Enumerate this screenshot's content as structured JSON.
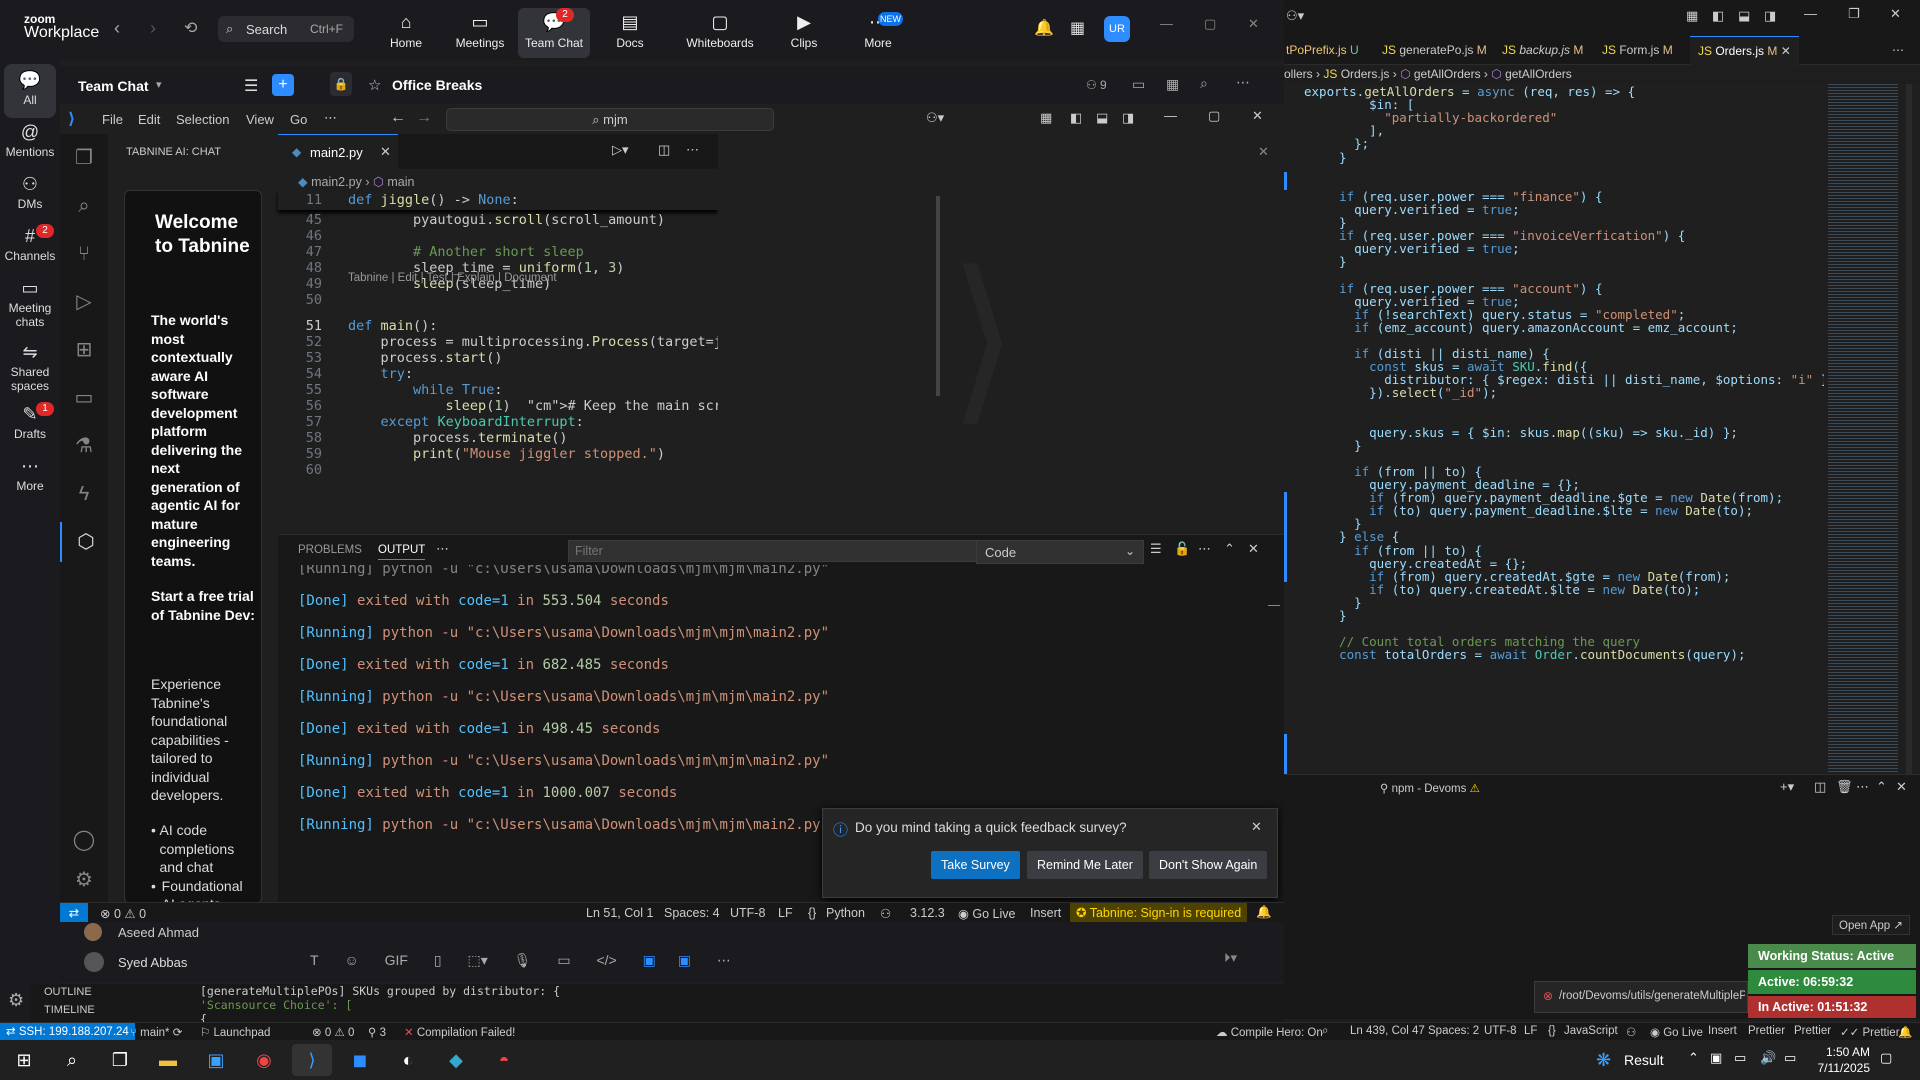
{
  "zoom": {
    "logo_line1": "zoom",
    "logo_line2": "Workplace",
    "search_label": "Search",
    "search_shortcut": "Ctrl+F",
    "tabs": [
      {
        "label": "Home"
      },
      {
        "label": "Meetings"
      },
      {
        "label": "Team Chat",
        "badge": "2"
      },
      {
        "label": "Docs"
      },
      {
        "label": "Whiteboards"
      },
      {
        "label": "Clips"
      },
      {
        "label": "More",
        "badge": "NEW"
      }
    ],
    "avatar": "UR",
    "left_nav": [
      {
        "label": "All"
      },
      {
        "label": "Mentions"
      },
      {
        "label": "DMs"
      },
      {
        "label": "Channels",
        "badge": "2"
      },
      {
        "label": "Meeting chats"
      },
      {
        "label": "Shared spaces"
      },
      {
        "label": "Drafts",
        "badge": "1"
      },
      {
        "label": "More"
      }
    ],
    "section_title": "Team Chat",
    "channel_title": "Office Breaks",
    "member_count": "9",
    "contacts": [
      "Aseed Ahmad",
      "Syed Abbas"
    ]
  },
  "vscode_left": {
    "menu": [
      "File",
      "Edit",
      "Selection",
      "View",
      "Go"
    ],
    "command_center": "mjm",
    "sidebar_title": "TABNINE AI: CHAT",
    "tabnine": {
      "welcome": "Welcome to Tabnine",
      "tagline": "The world's most contextually aware AI software development platform delivering the next generation of agentic AI for mature engineering teams.",
      "trial": "Start a free trial of Tabnine Dev:",
      "experience": "Experience Tabnine's foundational capabilities - tailored to individual developers.",
      "bullets": [
        "AI code completions and chat",
        "Foundational AI agents"
      ]
    },
    "tab": "main2.py",
    "breadcrumb_file": "main2.py",
    "breadcrumb_symbol": "main",
    "sticky_line": {
      "num": "11",
      "text": "def jiggle() -> None:"
    },
    "codelens": "Tabnine | Edit | Test | Explain | Document",
    "lines": [
      {
        "num": "45",
        "code": "        pyautogui.scroll(scroll_amount)"
      },
      {
        "num": "46",
        "code": ""
      },
      {
        "num": "47",
        "code": "        # Another short sleep"
      },
      {
        "num": "48",
        "code": "        sleep_time = uniform(1, 3)"
      },
      {
        "num": "49",
        "code": "        sleep(sleep_time)"
      },
      {
        "num": "50",
        "code": ""
      },
      {
        "num": "51",
        "code": "def main():"
      },
      {
        "num": "52",
        "code": "    process = multiprocessing.Process(target=ji"
      },
      {
        "num": "53",
        "code": "    process.start()"
      },
      {
        "num": "54",
        "code": "    try:"
      },
      {
        "num": "55",
        "code": "        while True:"
      },
      {
        "num": "56",
        "code": "            sleep(1)  # Keep the main script ru"
      },
      {
        "num": "57",
        "code": "    except KeyboardInterrupt:"
      },
      {
        "num": "58",
        "code": "        process.terminate()"
      },
      {
        "num": "59",
        "code": "        print(\"Mouse jiggler stopped.\")"
      },
      {
        "num": "60",
        "code": ""
      }
    ],
    "panel_tabs": [
      "PROBLEMS",
      "OUTPUT"
    ],
    "filter_placeholder": "Filter",
    "output_channel": "Code",
    "output_partial": "[Running] python -u \"c:\\Users\\usama\\Downloads\\mjm\\mjm\\main2.py\"",
    "output": [
      {
        "text": "[Done] exited with code=1 in 553.504 seconds",
        "kind": "done"
      },
      {
        "text": "[Running] python -u \"c:\\Users\\usama\\Downloads\\mjm\\mjm\\main2.py\"",
        "kind": "run"
      },
      {
        "text": "[Done] exited with code=1 in 682.485 seconds",
        "kind": "done"
      },
      {
        "text": "[Running] python -u \"c:\\Users\\usama\\Downloads\\mjm\\mjm\\main2.py\"",
        "kind": "run"
      },
      {
        "text": "[Done] exited with code=1 in 498.45 seconds",
        "kind": "done"
      },
      {
        "text": "[Running] python -u \"c:\\Users\\usama\\Downloads\\mjm\\mjm\\main2.py\"",
        "kind": "run"
      },
      {
        "text": "[Done] exited with code=1 in 1000.007 seconds",
        "kind": "done"
      },
      {
        "text": "[Running] python -u \"c:\\Users\\usama\\Downloads\\mjm\\mjm\\main2.py\"",
        "kind": "run"
      }
    ],
    "survey": {
      "question": "Do you mind taking a quick feedback survey?",
      "take": "Take Survey",
      "remind": "Remind Me Later",
      "dont": "Don't Show Again"
    },
    "status": {
      "errors": "0",
      "warnings": "0",
      "position": "Ln 51, Col 1",
      "spaces": "Spaces: 4",
      "encoding": "UTF-8",
      "eol": "LF",
      "language": "Python",
      "version": "3.12.3",
      "golive": "Go Live",
      "insert": "Insert",
      "tabnine": "Tabnine: Sign-in is required"
    }
  },
  "vscode_right": {
    "tabs": [
      {
        "label": "tPoPrefix.js",
        "flag": "U"
      },
      {
        "label": "generatePo.js",
        "flag": "M"
      },
      {
        "label": "backup.js",
        "flag": "M"
      },
      {
        "label": "Form.js",
        "flag": "M"
      },
      {
        "label": "Orders.js",
        "flag": "M"
      }
    ],
    "breadcrumb": [
      "ollers",
      "Orders.js",
      "getAllOrders",
      "getAllOrders"
    ],
    "code": [
      "exports.getAllOrders = async (req, res) => {",
      "      $in: [",
      "        \"partially-backordered\"",
      "      ],",
      "    };",
      "  }",
      "",
      "",
      "  if (req.user.power === \"finance\") {",
      "    query.verified = true;",
      "  }",
      "  if (req.user.power === \"invoiceVerfication\") {",
      "    query.verified = true;",
      "  }",
      "",
      "  if (req.user.power === \"account\") {",
      "    query.verified = true;",
      "    if (!searchText) query.status = \"completed\";",
      "    if (emz_account) query.amazonAccount = emz_account;",
      "",
      "    if (disti || disti_name) {",
      "      const skus = await SKU.find({",
      "        distributor: { $regex: disti || disti_name, $options: \"i\" }",
      "      }).select(\"_id\");",
      "",
      "",
      "      query.skus = { $in: skus.map((sku) => sku._id) };",
      "    }",
      "",
      "    if (from || to) {",
      "      query.payment_deadline = {};",
      "      if (from) query.payment_deadline.$gte = new Date(from);",
      "      if (to) query.payment_deadline.$lte = new Date(to);",
      "    }",
      "  } else {",
      "    if (from || to) {",
      "      query.createdAt = {};",
      "      if (from) query.createdAt.$gte = new Date(from);",
      "      if (to) query.createdAt.$lte = new Date(to);",
      "    }",
      "  }",
      "",
      "  // Count total orders matching the query",
      "  const totalOrders = await Order.countDocuments(query);"
    ],
    "terminal_name": "npm - Devoms",
    "open_app": "Open App",
    "working_status": "Working Status: Active",
    "active_time": "Active: 06:59:32",
    "inactive_time": "In Active: 01:51:32",
    "toast_path": "/root/Devoms/utils/generateMultipleP",
    "terminal_lines": [
      "[generateMultiplePOs] SKUs grouped by distributor: {",
      "  'Scansource Choice': [",
      "    {"
    ],
    "outline": "OUTLINE",
    "timeline": "TIMELINE"
  },
  "status_bottom": {
    "ssh": "SSH: 199.188.207.24",
    "branch": "main*",
    "launchpad": "Launchpad",
    "errors": "0",
    "warnings": "0",
    "ports": "3",
    "compile": "Compilation Failed!",
    "compile_hero": "Compile Hero: On",
    "position": "Ln 439, Col 47",
    "spaces": "Spaces: 2",
    "encoding": "UTF-8",
    "eol": "LF",
    "language": "JavaScript",
    "golive": "Go Live",
    "insert": "Insert",
    "prettier1": "Prettier",
    "prettier2": "Prettier",
    "prettier3": "Prettier"
  },
  "taskbar": {
    "result": "Result",
    "time": "1:50 AM",
    "date": "7/11/2025"
  }
}
